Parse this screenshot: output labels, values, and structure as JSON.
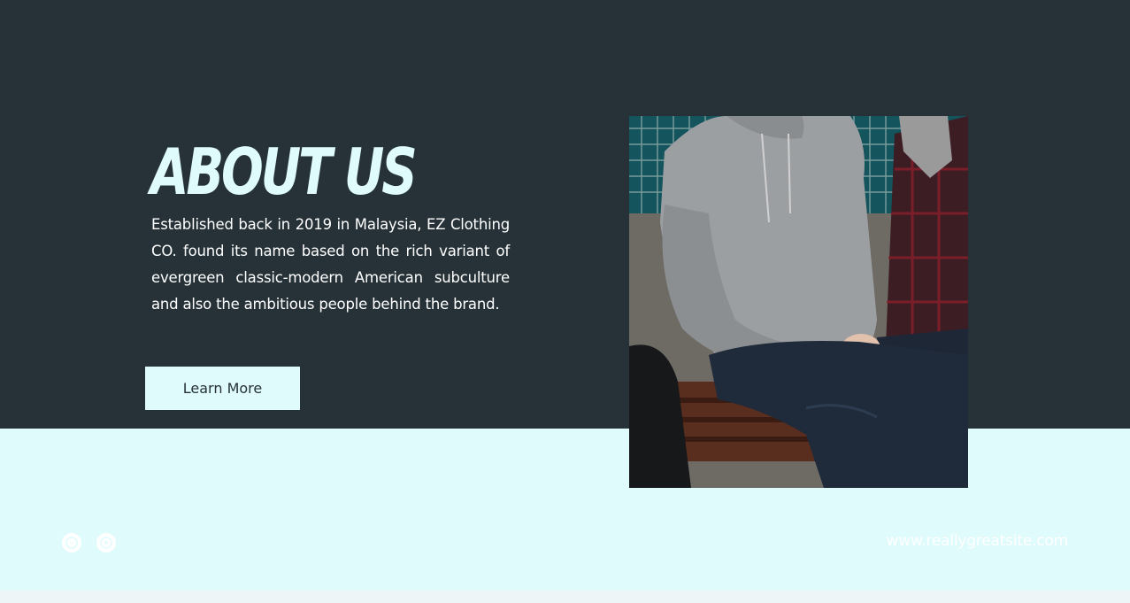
{
  "about": {
    "title": "ABOUT US",
    "description": "Established back in 2019 in Malaysia, EZ Clothing CO. found its name based on the rich variant of evergreen classic-modern American subculture and also the ambitious people behind the brand.",
    "button_label": "Learn More"
  },
  "footer": {
    "website": "www.reallygreatsite.com",
    "social_icons": [
      "messenger-icon",
      "play-icon"
    ]
  },
  "colors": {
    "dark": "#263238",
    "light": "#dffbfc",
    "text": "#ffffff"
  }
}
